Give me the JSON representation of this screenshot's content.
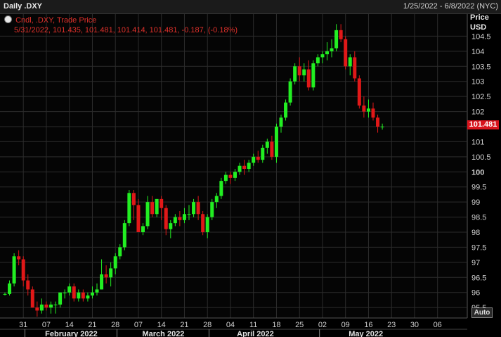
{
  "header": {
    "title": "Daily .DXY",
    "date_range": "1/25/2022 - 6/8/2022 (NYC)"
  },
  "legend": {
    "series": "Cndl, .DXY, Trade Price",
    "values": "5/31/2022, 101.435, 101.481, 101.414, 101.481, -0.187, (-0.18%)"
  },
  "axis": {
    "header_line1": "Price",
    "header_line2": "USD",
    "last_value": "101.481",
    "auto_label": "Auto"
  },
  "colors": {
    "up": "#22ee22",
    "down": "#e01818",
    "badge": "#d8141c",
    "grid": "#2c2c2c"
  },
  "chart_data": {
    "type": "candlestick",
    "title": "Daily .DXY",
    "ylabel": "Price USD",
    "ylim": [
      95.2,
      105.0
    ],
    "y_ticks": [
      95.5,
      96,
      96.5,
      97,
      97.5,
      98,
      98.5,
      99,
      99.5,
      100,
      100.5,
      101,
      101.5,
      102,
      102.5,
      103,
      103.5,
      104,
      104.5
    ],
    "x_ticks": [
      "31",
      "07",
      "14",
      "21",
      "28",
      "07",
      "14",
      "21",
      "28",
      "04",
      "11",
      "18",
      "25",
      "02",
      "09",
      "16",
      "23",
      "30",
      "06"
    ],
    "x_tick_index": [
      4,
      9,
      14,
      19,
      24,
      29,
      34,
      39,
      44,
      49,
      54,
      59,
      64,
      69,
      74,
      79,
      84,
      89,
      94
    ],
    "months": [
      {
        "label": "February 2022",
        "start_index": 5
      },
      {
        "label": "March 2022",
        "start_index": 25
      },
      {
        "label": "April 2022",
        "start_index": 45
      },
      {
        "label": "May 2022",
        "start_index": 69
      }
    ],
    "grid": true,
    "last_value": 101.481,
    "candles": [
      [
        95.95,
        96.0,
        95.9,
        95.95
      ],
      [
        95.95,
        96.4,
        95.9,
        96.3
      ],
      [
        96.3,
        97.3,
        96.2,
        97.2
      ],
      [
        97.2,
        97.4,
        96.9,
        97.1
      ],
      [
        97.1,
        97.2,
        96.2,
        96.4
      ],
      [
        96.4,
        96.6,
        95.9,
        96.1
      ],
      [
        96.1,
        96.2,
        95.5,
        95.5
      ],
      [
        95.5,
        95.7,
        95.2,
        95.4
      ],
      [
        95.4,
        95.8,
        95.3,
        95.6
      ],
      [
        95.6,
        95.7,
        95.4,
        95.5
      ],
      [
        95.5,
        95.7,
        95.3,
        95.6
      ],
      [
        95.6,
        95.7,
        95.3,
        95.6
      ],
      [
        95.6,
        96.0,
        95.5,
        96.0
      ],
      [
        96.0,
        96.1,
        95.8,
        96.0
      ],
      [
        96.0,
        96.3,
        95.9,
        96.2
      ],
      [
        96.2,
        96.3,
        95.7,
        95.8
      ],
      [
        95.8,
        96.1,
        95.7,
        96.0
      ],
      [
        96.0,
        96.1,
        95.7,
        95.8
      ],
      [
        95.8,
        96.0,
        95.7,
        95.9
      ],
      [
        95.9,
        96.2,
        95.8,
        96.0
      ],
      [
        96.0,
        96.3,
        95.9,
        96.1
      ],
      [
        96.1,
        97.1,
        96.1,
        96.6
      ],
      [
        96.6,
        96.9,
        96.3,
        96.5
      ],
      [
        96.5,
        97.0,
        96.2,
        96.8
      ],
      [
        96.8,
        97.3,
        96.6,
        97.2
      ],
      [
        97.2,
        97.6,
        97.1,
        97.5
      ],
      [
        97.5,
        98.4,
        97.4,
        98.3
      ],
      [
        98.3,
        99.4,
        98.2,
        99.3
      ],
      [
        99.3,
        99.4,
        98.4,
        98.9
      ],
      [
        98.9,
        99.1,
        98.0,
        98.0
      ],
      [
        98.0,
        98.3,
        97.9,
        98.2
      ],
      [
        98.2,
        99.2,
        98.1,
        99.0
      ],
      [
        99.0,
        99.2,
        98.5,
        98.6
      ],
      [
        98.6,
        99.1,
        98.5,
        99.1
      ],
      [
        99.1,
        99.2,
        98.4,
        98.8
      ],
      [
        98.8,
        98.9,
        97.9,
        98.1
      ],
      [
        98.1,
        98.4,
        97.8,
        98.3
      ],
      [
        98.3,
        98.6,
        98.2,
        98.5
      ],
      [
        98.5,
        98.7,
        98.2,
        98.4
      ],
      [
        98.4,
        98.8,
        98.3,
        98.6
      ],
      [
        98.6,
        98.9,
        98.4,
        98.6
      ],
      [
        98.6,
        99.1,
        98.5,
        99.0
      ],
      [
        99.0,
        99.2,
        98.4,
        98.6
      ],
      [
        98.6,
        98.7,
        97.9,
        98.0
      ],
      [
        98.0,
        98.6,
        97.8,
        98.5
      ],
      [
        98.5,
        99.1,
        98.4,
        99.0
      ],
      [
        99.0,
        99.3,
        98.8,
        99.2
      ],
      [
        99.2,
        99.8,
        99.1,
        99.7
      ],
      [
        99.7,
        100.0,
        99.6,
        99.9
      ],
      [
        99.9,
        100.0,
        99.6,
        99.8
      ],
      [
        99.8,
        100.1,
        99.7,
        100.0
      ],
      [
        100.0,
        100.3,
        99.9,
        100.2
      ],
      [
        100.2,
        100.4,
        99.9,
        100.1
      ],
      [
        100.1,
        100.4,
        100.0,
        100.3
      ],
      [
        100.3,
        100.6,
        100.2,
        100.5
      ],
      [
        100.5,
        100.7,
        100.3,
        100.4
      ],
      [
        100.4,
        100.9,
        100.3,
        100.8
      ],
      [
        100.8,
        101.1,
        100.6,
        101.0
      ],
      [
        101.0,
        101.2,
        100.4,
        100.5
      ],
      [
        100.5,
        101.6,
        100.3,
        101.5
      ],
      [
        101.5,
        101.9,
        101.3,
        101.8
      ],
      [
        101.8,
        102.4,
        101.7,
        102.3
      ],
      [
        102.3,
        103.1,
        102.2,
        103.0
      ],
      [
        103.0,
        103.6,
        102.9,
        103.5
      ],
      [
        103.5,
        103.8,
        103.0,
        103.2
      ],
      [
        103.2,
        103.6,
        103.0,
        103.4
      ],
      [
        103.4,
        103.7,
        102.7,
        102.8
      ],
      [
        102.8,
        103.7,
        102.7,
        103.6
      ],
      [
        103.6,
        103.9,
        103.5,
        103.8
      ],
      [
        103.8,
        104.0,
        103.6,
        103.9
      ],
      [
        103.9,
        104.3,
        103.7,
        104.0
      ],
      [
        104.0,
        104.4,
        103.8,
        104.1
      ],
      [
        104.1,
        104.9,
        104.0,
        104.7
      ],
      [
        104.7,
        104.9,
        104.3,
        104.4
      ],
      [
        104.4,
        104.5,
        103.4,
        103.5
      ],
      [
        103.5,
        103.9,
        103.2,
        103.8
      ],
      [
        103.8,
        104.0,
        103.0,
        103.1
      ],
      [
        103.1,
        103.2,
        102.1,
        102.2
      ],
      [
        102.2,
        102.5,
        101.8,
        102.0
      ],
      [
        102.0,
        102.4,
        101.8,
        102.1
      ],
      [
        102.1,
        102.3,
        101.7,
        101.8
      ],
      [
        101.8,
        101.9,
        101.3,
        101.5
      ],
      [
        101.5,
        101.6,
        101.4,
        101.5
      ]
    ]
  }
}
